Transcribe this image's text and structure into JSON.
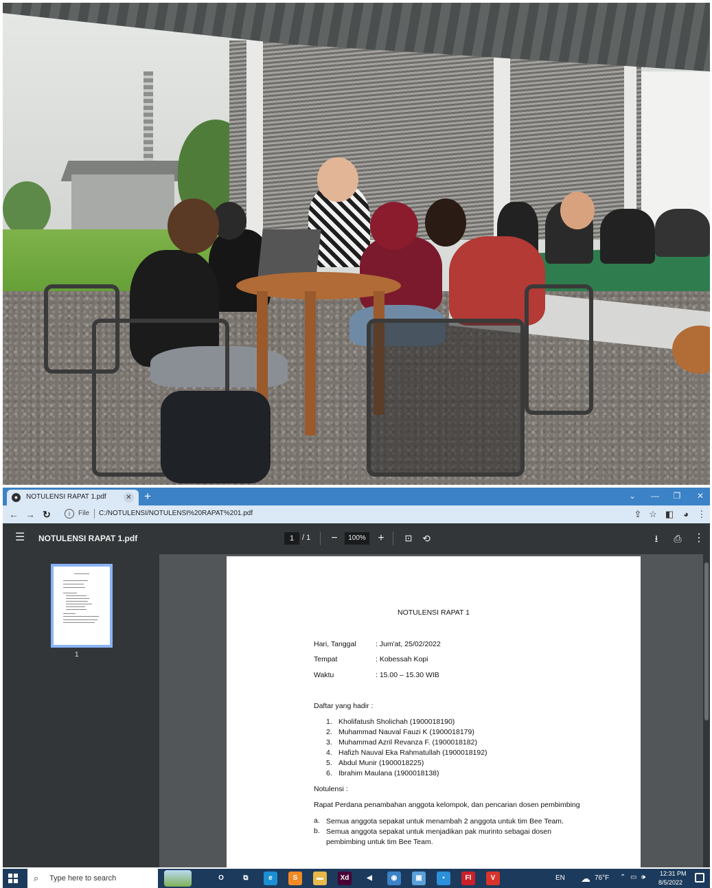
{
  "browser": {
    "tab_title": "NOTULENSI RAPAT 1.pdf",
    "url_scheme_label": "File",
    "url": "C:/NOTULENSI/NOTULENSI%20RAPAT%201.pdf"
  },
  "viewer": {
    "doc_title": "NOTULENSI RAPAT 1.pdf",
    "page_current": "1",
    "page_total": "/ 1",
    "zoom": "100%",
    "thumbnail_label": "1"
  },
  "document": {
    "title": "NOTULENSI RAPAT 1",
    "info": [
      {
        "label": "Hari, Tanggal",
        "value": ": Jum'at, 25/02/2022"
      },
      {
        "label": "Tempat",
        "value": ": Kobessah Kopi"
      },
      {
        "label": "Waktu",
        "value": ": 15.00 – 15.30 WIB"
      }
    ],
    "attendance_heading": "Daftar yang hadir :",
    "attendance": [
      {
        "num": "1.",
        "name": "Kholifatush Sholichah (1900018190)"
      },
      {
        "num": "2.",
        "name": "Muhammad Nauval Fauzi K (1900018179)"
      },
      {
        "num": "3.",
        "name": "Muhammad Azril Revanza F. (1900018182)"
      },
      {
        "num": "4.",
        "name": "Hafizh Nauval Eka Rahmatullah (1900018192)"
      },
      {
        "num": "5.",
        "name": "Abdul Munir (1900018225)"
      },
      {
        "num": "6.",
        "name": "Ibrahim Maulana (1900018138)"
      }
    ],
    "notes_heading": "Notulensi :",
    "summary": "Rapat Perdana penambahan anggota kelompok, dan pencarian dosen pembimbing",
    "notes": [
      {
        "letter": "a.",
        "text": "Semua anggota sepakat untuk menambah 2 anggota untuk tim Bee Team."
      },
      {
        "letter": "b.",
        "text": "Semua anggota sepakat untuk menjadikan pak murinto sebagai dosen pembimbing untuk tim Bee Team."
      }
    ]
  },
  "taskbar": {
    "search_placeholder": "Type here to search",
    "language": "EN",
    "temperature": "76°F",
    "time": "12:31 PM",
    "date": "8/5/2022",
    "apps": [
      {
        "icon": "cortana-icon",
        "glyph": "O",
        "color": "#1c3a5c"
      },
      {
        "icon": "task-view-icon",
        "glyph": "⧉",
        "color": "#1c3a5c"
      },
      {
        "icon": "edge-icon",
        "glyph": "e",
        "color": "#1b8fd3"
      },
      {
        "icon": "sublime-icon",
        "glyph": "S",
        "color": "#f08a24"
      },
      {
        "icon": "file-explorer-icon",
        "glyph": "▬",
        "color": "#e7b84a"
      },
      {
        "icon": "adobe-xd-icon",
        "glyph": "Xd",
        "color": "#470137"
      },
      {
        "icon": "vscode-icon",
        "glyph": "◀",
        "color": "#1c3a5c"
      },
      {
        "icon": "chrome-icon",
        "glyph": "◉",
        "color": "#3b82c6"
      },
      {
        "icon": "app-icon",
        "glyph": "▣",
        "color": "#5aa0d8"
      },
      {
        "icon": "app2-icon",
        "glyph": "▪",
        "color": "#2b8fd9"
      },
      {
        "icon": "flash-icon",
        "glyph": "Fl",
        "color": "#c9202a"
      },
      {
        "icon": "vectr-icon",
        "glyph": "V",
        "color": "#d9342b"
      }
    ]
  },
  "colors": {
    "tab_bar": "#3b82c6",
    "viewer_toolbar": "#323639",
    "viewer_bg": "#525659",
    "taskbar": "#1c3a5c"
  }
}
